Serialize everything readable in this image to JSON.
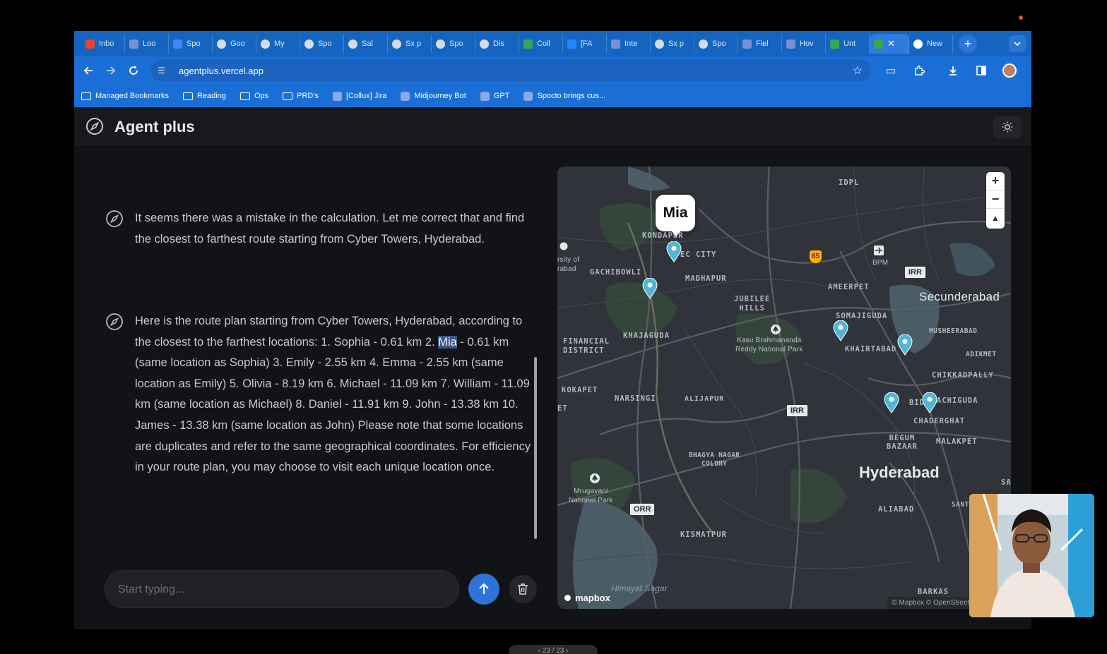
{
  "browser": {
    "tabs": [
      {
        "label": "Inbo",
        "icon": "gmail-icon"
      },
      {
        "label": "Loo",
        "icon": "app-icon"
      },
      {
        "label": "Spo",
        "icon": "docs-icon"
      },
      {
        "label": "Goo",
        "icon": "chatgpt-icon"
      },
      {
        "label": "My",
        "icon": "chatgpt-icon"
      },
      {
        "label": "Spo",
        "icon": "chatgpt-icon"
      },
      {
        "label": "Sal",
        "icon": "chatgpt-icon"
      },
      {
        "label": "Sx p",
        "icon": "chatgpt-icon"
      },
      {
        "label": "Spo",
        "icon": "chatgpt-icon"
      },
      {
        "label": "Dis",
        "icon": "chatgpt-icon"
      },
      {
        "label": "Coll",
        "icon": "sheets-icon"
      },
      {
        "label": "[FA",
        "icon": "jira-icon"
      },
      {
        "label": "Inte",
        "icon": "app-icon"
      },
      {
        "label": "Sx p",
        "icon": "chatgpt-icon"
      },
      {
        "label": "Spo",
        "icon": "chatgpt-icon"
      },
      {
        "label": "Fiel",
        "icon": "app-icon"
      },
      {
        "label": "Hov",
        "icon": "app-icon"
      },
      {
        "label": "Unt",
        "icon": "sheets-icon"
      }
    ],
    "active_tab": {
      "label": "",
      "close": "✕"
    },
    "last_tab": {
      "label": "New"
    },
    "new_tab": "+",
    "url": "agentplus.vercel.app",
    "bookmarks": [
      {
        "label": "Managed Bookmarks",
        "icon": "folder-icon"
      },
      {
        "label": "Reading",
        "icon": "folder-icon"
      },
      {
        "label": "Ops",
        "icon": "folder-icon"
      },
      {
        "label": "PRD's",
        "icon": "folder-icon"
      },
      {
        "label": "[Collux] Jira",
        "icon": "jira-icon"
      },
      {
        "label": "Midjourney Bot",
        "icon": "app-icon"
      },
      {
        "label": "GPT",
        "icon": "chatgpt-icon"
      },
      {
        "label": "Spocto brings cus...",
        "icon": "app-icon"
      }
    ]
  },
  "app": {
    "title": "Agent plus",
    "messages": [
      {
        "text": "It seems there was a mistake in the calculation. Let me correct that and find the closest to farthest route starting from Cyber Towers, Hyderabad."
      },
      {
        "before": "Here is the route plan starting from Cyber Towers, Hyderabad, according to the closest to the farthest locations: 1. Sophia - 0.61 km 2. ",
        "highlight": "Mia",
        "after": " - 0.61 km (same location as Sophia) 3. Emily - 2.55 km 4. Emma - 2.55 km (same location as Emily) 5. Olivia - 8.19 km 6. Michael - 11.09 km 7. William - 11.09 km (same location as Michael) 8. Daniel - 11.91 km 9. John - 13.38 km 10. James - 13.38 km (same location as John) Please note that some locations are duplicates and refer to the same geographical coordinates. For efficiency in your route plan, you may choose to visit each unique location once."
      }
    ],
    "composer": {
      "placeholder": "Start typing..."
    }
  },
  "map": {
    "popup": "Mia",
    "labels": {
      "idpl": "IDPL",
      "kondapur": "KONDAPUR",
      "hitec": "EC CITY",
      "university": "rsity of\nrabad",
      "gachibowli": "GACHIBOWLI",
      "madhapur": "MADHAPUR",
      "jubilee": "JUBILEE\nHILLS",
      "ameerpet": "AMEERPET",
      "bpm": "BPM",
      "secunderabad": "Secunderabad",
      "somajiguda": "SOMAJIGUDA",
      "musheerabad": "MUSHEERABAD",
      "khairtabad": "KHAIRTABAD",
      "adikmet": "ADIKMET",
      "financial": "FINANCIAL\nDISTRICT",
      "khajaguda": "KHAJAGUDA",
      "kbr": "Kasu Brahmananda\nReddy National Park",
      "chikkadpally": "CHIKKADPALLY",
      "kokapet": "KOKAPET",
      "narsingi": "NARSINGI",
      "alijapur": "ALIJAPUR",
      "bids": "BIDS",
      "achiguda": "ACHIGUDA",
      "chaderghat": "CHADERGHAT",
      "begum": "BEGUM\nBAZAAR",
      "malakpet": "MALAKPET",
      "et": "ET",
      "bhagya": "BHAGYA NAGAR\nCOLONY",
      "hyderabad": "Hyderabad",
      "sa": "SA",
      "mrugavani": "Mrugavani\nNational Park",
      "alibad": "ALIABAD",
      "santos": "SANTOS",
      "kismatpur": "KISMATPUR",
      "himayat": "Himayat Sagar",
      "barkas": "BARKAS"
    },
    "shields": {
      "nh65": "65",
      "irr1": "IRR",
      "irr2": "IRR",
      "orr": "ORR"
    },
    "zoom_in": "+",
    "zoom_out": "−",
    "compass": "▲",
    "logo": "mapbox",
    "attribution": "© Mapbox © OpenStreetMap Improv",
    "colors": {
      "pin": "#4fb6d6",
      "water": "#4a5d66",
      "park": "#3a4a3e",
      "road": "#5a5e66"
    }
  },
  "overlay": {
    "page_indicator": "‹ 23 / 23 ›"
  }
}
